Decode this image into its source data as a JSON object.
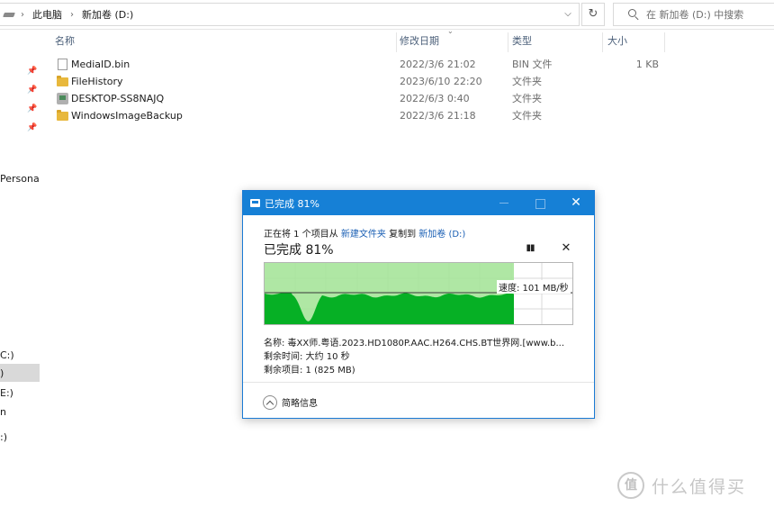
{
  "address": {
    "crumbs": [
      "此电脑",
      "新加卷 (D:)"
    ],
    "drive_icon": "drive-icon",
    "dropdown_icon": "chevron-down-icon",
    "refresh_icon": "refresh-icon"
  },
  "search": {
    "placeholder": "在 新加卷 (D:) 中搜索",
    "icon": "search-icon"
  },
  "nav": {
    "partial_labels": [
      "Persona",
      "C:)",
      ")",
      "E:)",
      "n",
      ":)"
    ],
    "pins": 4
  },
  "columns": {
    "name": "名称",
    "date": "修改日期",
    "type": "类型",
    "size": "大小"
  },
  "files": [
    {
      "name": "MediaID.bin",
      "date": "2022/3/6 21:02",
      "type": "BIN 文件",
      "size": "1 KB",
      "icon": "file-icon"
    },
    {
      "name": "FileHistory",
      "date": "2023/6/10 22:20",
      "type": "文件夹",
      "size": "",
      "icon": "folder-icon"
    },
    {
      "name": "DESKTOP-SS8NAJQ",
      "date": "2022/6/3 0:40",
      "type": "文件夹",
      "size": "",
      "icon": "network-folder-icon"
    },
    {
      "name": "WindowsImageBackup",
      "date": "2022/3/6 21:18",
      "type": "文件夹",
      "size": "",
      "icon": "folder-icon"
    }
  ],
  "dialog": {
    "title": "已完成 81%",
    "line1_prefix": "正在将 1 个项目从 ",
    "line1_src": "新建文件夹",
    "line1_mid": " 复制到 ",
    "line1_dst": "新加卷 (D:)",
    "progress_text": "已完成 81%",
    "progress_fraction": 0.81,
    "speed": "速度: 101 MB/秒",
    "name_line": "名称: 毒XX师.粤语.2023.HD1080P.AAC.H264.CHS.BT世界网.[www.b...",
    "time_line": "剩余时间: 大约 10 秒",
    "items_line": "剩余项目: 1 (825 MB)",
    "details_label": "简略信息",
    "colors": {
      "title_bar": "#1680d6",
      "graph_fill": "#06b025",
      "graph_bg": "#a6e49a"
    }
  },
  "watermark": {
    "badge": "值",
    "text": "什么值得买"
  }
}
